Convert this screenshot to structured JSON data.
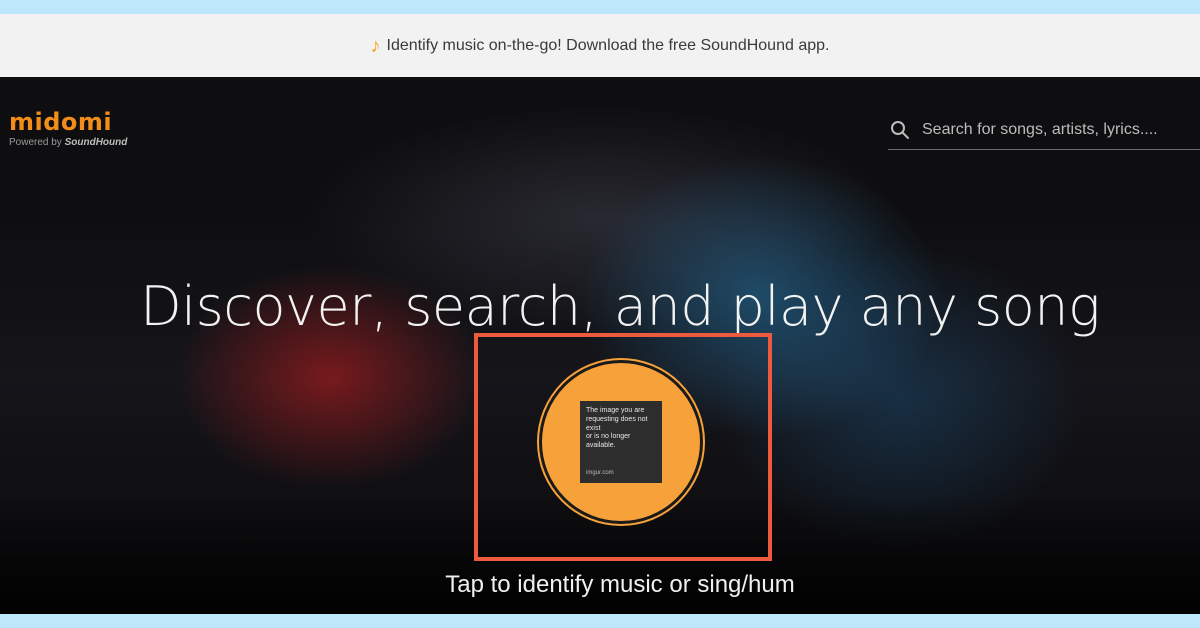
{
  "banner": {
    "icon": "music-note-icon",
    "text": "Identify music on-the-go! Download the free SoundHound app."
  },
  "header": {
    "logo_text": "midomi",
    "powered_prefix": "Powered by",
    "powered_brand": "SoundHound",
    "search": {
      "icon": "search-icon",
      "placeholder": "Search for songs, artists, lyrics...."
    }
  },
  "hero": {
    "headline": "Discover, search, and play any song",
    "listen_button": {
      "placeholder_lines": [
        "The image you are",
        "requesting does not exist",
        "or is no longer available."
      ],
      "placeholder_source": "imgur.com"
    },
    "tap_text": "Tap to identify music or sing/hum"
  },
  "colors": {
    "brand_orange": "#f28c1a",
    "button_orange": "#f7a13a",
    "highlight_border": "#ee5a3d",
    "banner_bg": "#f2f2f2",
    "page_bg": "#0b0b0c"
  }
}
